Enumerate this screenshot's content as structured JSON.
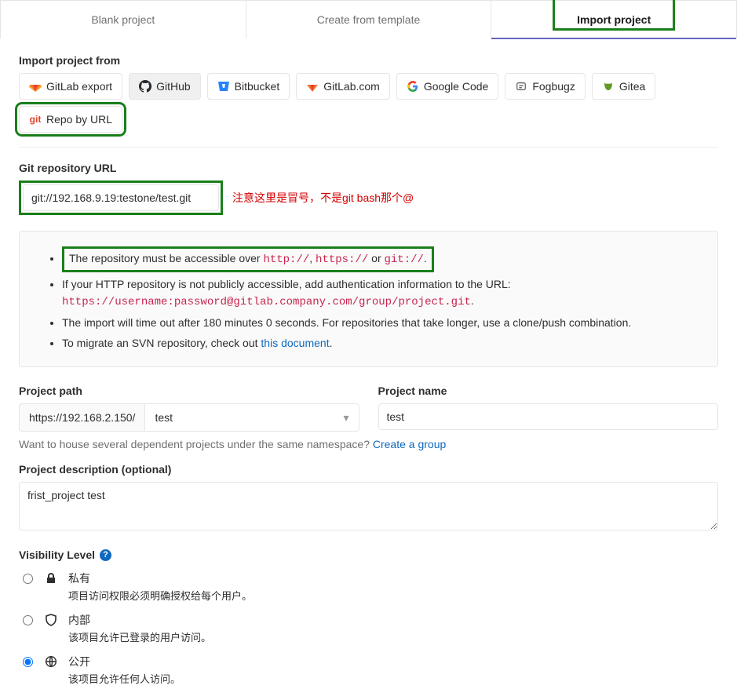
{
  "tabs": {
    "blank": "Blank project",
    "template": "Create from template",
    "import": "Import project"
  },
  "import_from_label": "Import project from",
  "sources": {
    "gitlab_export": "GitLab export",
    "github": "GitHub",
    "bitbucket": "Bitbucket",
    "gitlab_com": "GitLab.com",
    "google_code": "Google Code",
    "fogbugz": "Fogbugz",
    "gitea": "Gitea",
    "repo_by_url": "Repo by URL"
  },
  "repo_url": {
    "label": "Git repository URL",
    "value": "git://192.168.9.19:testone/test.git",
    "note": "注意这里是冒号，不是git bash那个@"
  },
  "info": {
    "line1_a": "The repository must be accessible over ",
    "line1_proto1": "http://",
    "line1_sep": ", ",
    "line1_proto2": "https://",
    "line1_or": " or ",
    "line1_proto3": "git://",
    "line1_dot": ".",
    "line2_a": "If your HTTP repository is not publicly accessible, add authentication information to the URL:",
    "line2_code": "https://username:password@gitlab.company.com/group/project.git",
    "line2_dot": ".",
    "line3": "The import will time out after 180 minutes 0 seconds. For repositories that take longer, use a clone/push combination.",
    "line4_a": "To migrate an SVN repository, check out ",
    "line4_link": "this document",
    "line4_dot": "."
  },
  "path": {
    "label": "Project path",
    "prefix": "https://192.168.2.150/",
    "slug": "test"
  },
  "name": {
    "label": "Project name",
    "value": "test"
  },
  "hint_a": "Want to house several dependent projects under the same namespace? ",
  "hint_link": "Create a group",
  "desc": {
    "label": "Project description (optional)",
    "value": "frist_project test"
  },
  "visibility": {
    "label": "Visibility Level",
    "private_t": "私有",
    "private_d": "项目访问权限必须明确授权给每个用户。",
    "internal_t": "内部",
    "internal_d": "该项目允许已登录的用户访问。",
    "public_t": "公开",
    "public_d": "该项目允许任何人访问。",
    "selected": "public"
  }
}
